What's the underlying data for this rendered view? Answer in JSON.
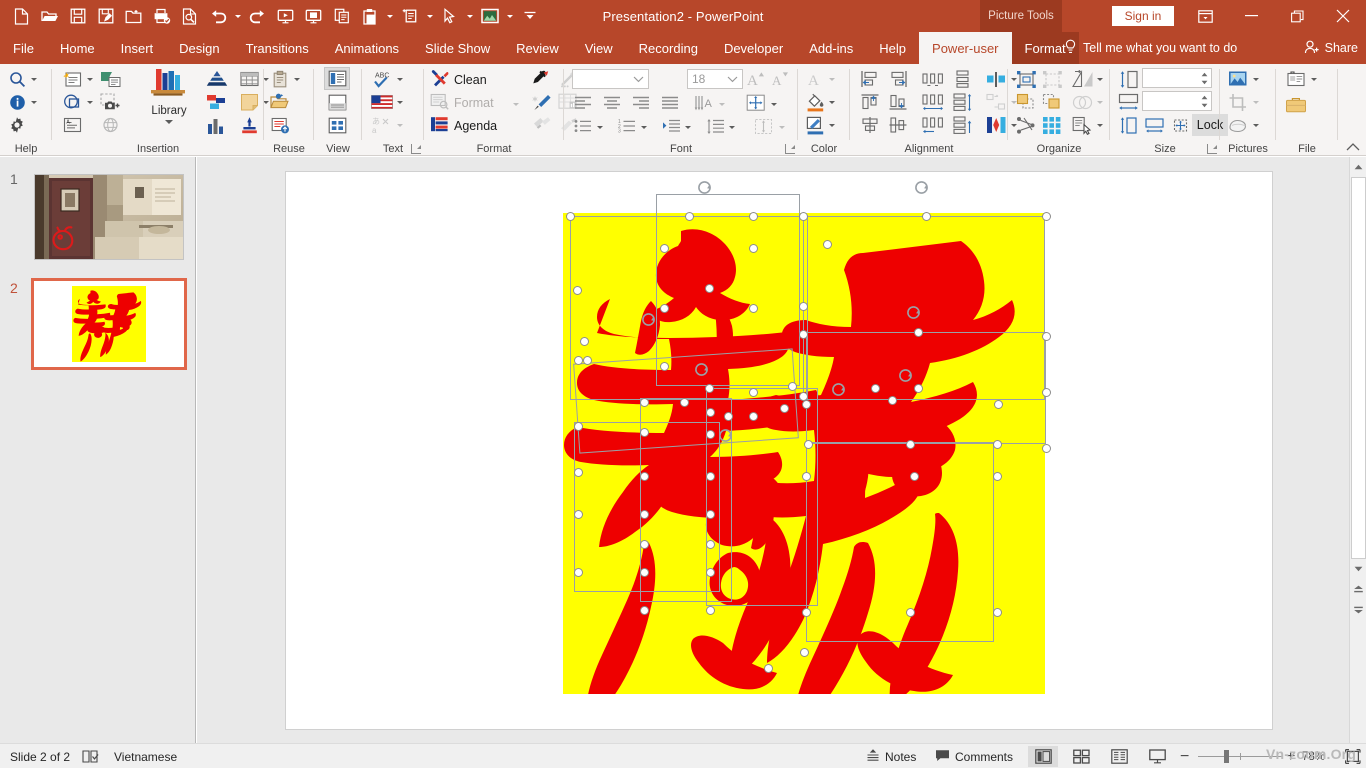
{
  "titlebar": {
    "document_title": "Presentation2  -  PowerPoint",
    "contextual_tools_label": "Picture Tools",
    "sign_in_label": "Sign in",
    "quick_access": [
      {
        "name": "new-file-icon",
        "label": "New"
      },
      {
        "name": "open-folder-icon",
        "label": "Open"
      },
      {
        "name": "save-icon",
        "label": "Save"
      },
      {
        "name": "save-as-icon",
        "label": "Save As"
      },
      {
        "name": "new-slide-icon",
        "label": "New Slide"
      },
      {
        "name": "quick-print-icon",
        "label": "Quick Print"
      },
      {
        "name": "print-preview-icon",
        "label": "Print Preview"
      },
      {
        "name": "undo-icon",
        "label": "Undo"
      },
      {
        "name": "redo-icon",
        "label": "Redo"
      },
      {
        "name": "start-from-beginning-icon",
        "label": "Start From Beginning"
      },
      {
        "name": "start-from-current-icon",
        "label": "Start From Current Slide"
      },
      {
        "name": "copy-icon",
        "label": "Copy"
      },
      {
        "name": "paste-icon",
        "label": "Paste"
      },
      {
        "name": "new-slide-layout-icon",
        "label": "New Slide"
      },
      {
        "name": "select-pointer-icon",
        "label": "Select"
      },
      {
        "name": "picture-icon",
        "label": "Picture"
      },
      {
        "name": "customize-qat-icon",
        "label": "Customize Quick Access Toolbar"
      }
    ],
    "window_buttons": [
      {
        "name": "ribbon-display-options-icon",
        "label": "Ribbon Display Options"
      },
      {
        "name": "minimize-icon",
        "label": "Minimize"
      },
      {
        "name": "restore-icon",
        "label": "Restore Down"
      },
      {
        "name": "close-icon",
        "label": "Close"
      }
    ]
  },
  "tabs": {
    "items": [
      {
        "label": "File",
        "active": false,
        "contextual": false
      },
      {
        "label": "Home",
        "active": false,
        "contextual": false
      },
      {
        "label": "Insert",
        "active": false,
        "contextual": false
      },
      {
        "label": "Design",
        "active": false,
        "contextual": false
      },
      {
        "label": "Transitions",
        "active": false,
        "contextual": false
      },
      {
        "label": "Animations",
        "active": false,
        "contextual": false
      },
      {
        "label": "Slide Show",
        "active": false,
        "contextual": false
      },
      {
        "label": "Review",
        "active": false,
        "contextual": false
      },
      {
        "label": "View",
        "active": false,
        "contextual": false
      },
      {
        "label": "Recording",
        "active": false,
        "contextual": false
      },
      {
        "label": "Developer",
        "active": false,
        "contextual": false
      },
      {
        "label": "Add-ins",
        "active": false,
        "contextual": false
      },
      {
        "label": "Help",
        "active": false,
        "contextual": false
      },
      {
        "label": "Power-user",
        "active": true,
        "contextual": false
      },
      {
        "label": "Format",
        "active": false,
        "contextual": true
      }
    ],
    "tell_me_placeholder": "Tell me what you want to do",
    "share_label": "Share"
  },
  "ribbon": {
    "groups": [
      {
        "name": "help",
        "label": "Help"
      },
      {
        "name": "insertion",
        "label": "Insertion",
        "library_label": "Library"
      },
      {
        "name": "reuse",
        "label": "Reuse"
      },
      {
        "name": "view",
        "label": "View"
      },
      {
        "name": "text",
        "label": "Text"
      },
      {
        "name": "format",
        "label": "Format"
      },
      {
        "name": "font",
        "label": "Font"
      },
      {
        "name": "color",
        "label": "Color"
      },
      {
        "name": "alignment",
        "label": "Alignment"
      },
      {
        "name": "organize",
        "label": "Organize"
      },
      {
        "name": "size",
        "label": "Size"
      },
      {
        "name": "pictures",
        "label": "Pictures"
      },
      {
        "name": "file",
        "label": "File"
      }
    ],
    "format_buttons": {
      "clean": "Clean",
      "format": "Format",
      "agenda": "Agenda"
    },
    "font": {
      "font_name_value": "",
      "font_size_value": "18"
    },
    "size": {
      "height_value": "",
      "width_value": "",
      "lock_label": "Lock"
    }
  },
  "thumbnails": {
    "slides": [
      {
        "number": "1",
        "selected": false,
        "description": "library-books-photo"
      },
      {
        "number": "2",
        "selected": true,
        "description": "yellow-red-calligraphy"
      }
    ]
  },
  "statusbar": {
    "slide_counter": "Slide 2 of 2",
    "language": "Vietnamese",
    "notes_label": "Notes",
    "comments_label": "Comments",
    "zoom_level": "78%",
    "watermark": "Vn-zoom.Org",
    "view_buttons": [
      {
        "name": "normal-view-icon",
        "label": "Normal",
        "active": true
      },
      {
        "name": "slide-sorter-icon",
        "label": "Slide Sorter",
        "active": false
      },
      {
        "name": "reading-view-icon",
        "label": "Reading View",
        "active": false
      },
      {
        "name": "slide-show-icon",
        "label": "Slide Show",
        "active": false
      }
    ],
    "zoom_out_label": "Zoom Out",
    "zoom_in_label": "Zoom In",
    "fit_slide_label": "Fit slide to current window"
  },
  "colors": {
    "ribbon_accent": "#b7472a",
    "contextual_tab": "#9c3a20",
    "ribbon_bg": "#f6f4f3",
    "artwork_background": "#ffff00",
    "artwork_ink": "#ee0000",
    "selection_border": "#e0674a"
  }
}
